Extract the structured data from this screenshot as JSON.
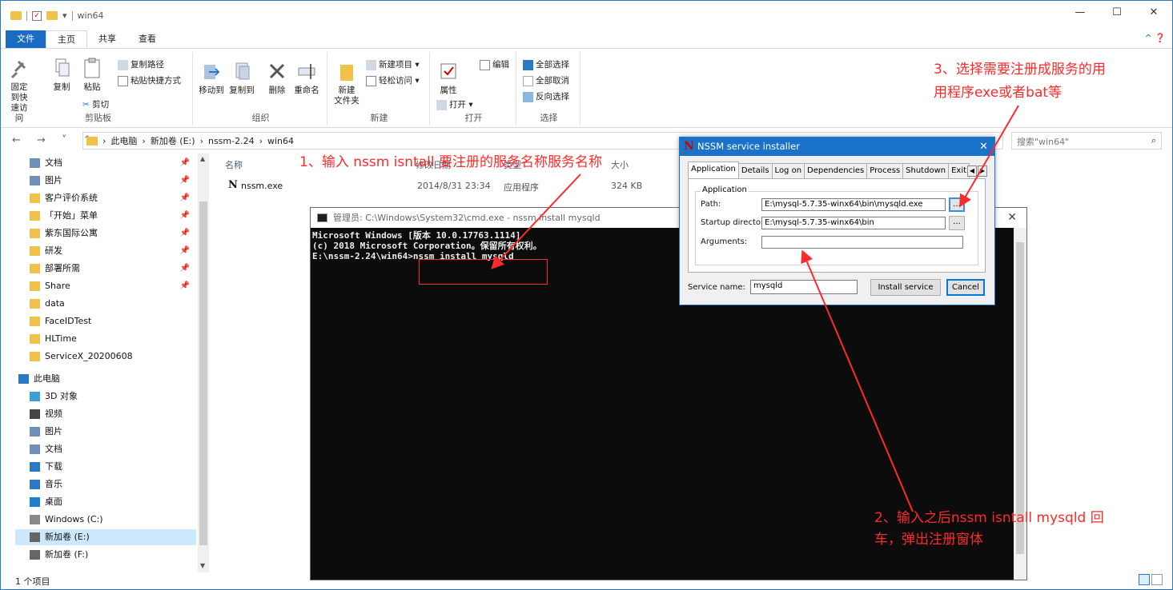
{
  "window": {
    "title": "win64",
    "controls": {
      "minimize": "—",
      "maximize": "☐",
      "close": "✕"
    }
  },
  "ribbon": {
    "tabs": {
      "file": "文件",
      "home": "主页",
      "share": "共享",
      "view": "查看"
    },
    "help": "^ ❓",
    "groups": {
      "clipboard": {
        "label": "剪贴板",
        "pin": "固定到快速访问",
        "pin_l1": "固定到快",
        "pin_l2": "速访问",
        "copy": "复制",
        "paste": "粘贴",
        "copy_path": "复制路径",
        "paste_shortcut": "粘贴快捷方式",
        "cut": "剪切"
      },
      "organize": {
        "label": "组织",
        "move_to": "移动到",
        "copy_to": "复制到",
        "delete": "删除",
        "rename": "重命名"
      },
      "new": {
        "label": "新建",
        "new_folder_l1": "新建",
        "new_folder_l2": "文件夹",
        "new_item": "新建项目 ▾",
        "easy_access": "轻松访问 ▾"
      },
      "open": {
        "label": "打开",
        "properties": "属性",
        "open": "打开 ▾",
        "edit": "编辑"
      },
      "select": {
        "label": "选择",
        "select_all": "全部选择",
        "select_none": "全部取消",
        "invert": "反向选择"
      }
    }
  },
  "address": {
    "nav": "← → ˅ ↑",
    "crumbs": [
      "›",
      "此电脑",
      "›",
      "新加卷 (E:)",
      "›",
      "nssm-2.24",
      "›",
      "win64"
    ],
    "search_placeholder": "搜索\"win64\"",
    "search_icon": "⌕"
  },
  "nav_pane": {
    "quick": [
      {
        "label": "文档",
        "pin": "📌",
        "color": "#6e8fb8"
      },
      {
        "label": "图片",
        "pin": "📌",
        "color": "#6e8fb8"
      },
      {
        "label": "客户评价系统",
        "pin": "📌",
        "color": "#f0c24a"
      },
      {
        "label": "「开始」菜单",
        "pin": "📌",
        "color": "#f0c24a"
      },
      {
        "label": "紫东国际公寓",
        "pin": "📌",
        "color": "#f0c24a"
      },
      {
        "label": "研发",
        "pin": "📌",
        "color": "#f0c24a"
      },
      {
        "label": "部署所需",
        "pin": "📌",
        "color": "#f0c24a"
      },
      {
        "label": "Share",
        "pin": "📌",
        "color": "#f0c24a"
      },
      {
        "label": "data",
        "pin": "",
        "color": "#f0c24a"
      },
      {
        "label": "FaceIDTest",
        "pin": "",
        "color": "#f0c24a"
      },
      {
        "label": "HLTime",
        "pin": "",
        "color": "#f0c24a"
      },
      {
        "label": "ServiceX_20200608",
        "pin": "",
        "color": "#f0c24a"
      }
    ],
    "this_pc": "此电脑",
    "pc_items": [
      {
        "label": "3D 对象",
        "color": "#3aa0d8"
      },
      {
        "label": "视频",
        "color": "#444"
      },
      {
        "label": "图片",
        "color": "#6e8fb8"
      },
      {
        "label": "文档",
        "color": "#6e8fb8"
      },
      {
        "label": "下载",
        "color": "#2b78c5"
      },
      {
        "label": "音乐",
        "color": "#2b78c5"
      },
      {
        "label": "桌面",
        "color": "#1e7fd1"
      },
      {
        "label": "Windows (C:)",
        "color": "#888"
      },
      {
        "label": "新加卷 (E:)",
        "color": "#666"
      },
      {
        "label": "新加卷 (F:)",
        "color": "#666"
      }
    ]
  },
  "file_list": {
    "columns": {
      "name": "名称",
      "date": "修改日期",
      "type": "类型",
      "size": "大小"
    },
    "rows": [
      {
        "icon": "N",
        "name": "nssm.exe",
        "date": "2014/8/31 23:34",
        "type": "应用程序",
        "size": "324 KB"
      }
    ]
  },
  "status": {
    "count": "1 个项目"
  },
  "cmd": {
    "title": "管理员: C:\\Windows\\System32\\cmd.exe - nssm  install mysqld",
    "close": "✕",
    "lines": [
      "Microsoft Windows [版本 10.0.17763.1114]",
      "(c) 2018 Microsoft Corporation。保留所有权利。",
      "",
      "E:\\nssm-2.24\\win64>nssm install mysqld"
    ]
  },
  "nssm": {
    "title": "NSSM service installer",
    "logo": "N",
    "close": "✕",
    "tabs": [
      "Application",
      "Details",
      "Log on",
      "Dependencies",
      "Process",
      "Shutdown",
      "Exit"
    ],
    "tab_arrows": [
      "◀",
      "▶"
    ],
    "group": "Application",
    "path_label": "Path:",
    "path_value": "E:\\mysql-5.7.35-winx64\\bin\\mysqld.exe",
    "startup_label": "Startup directory:",
    "startup_value": "E:\\mysql-5.7.35-winx64\\bin",
    "args_label": "Arguments:",
    "args_value": "",
    "browse": "...",
    "service_name_label": "Service name:",
    "service_name_value": "mysqld",
    "install_btn": "Install service",
    "cancel_btn": "Cancel"
  },
  "annotations": {
    "step1": "1、输入 nssm isntall  要注册的服务名称服务名称",
    "step2_l1": "2、输入之后nssm isntall mysqld 回",
    "step2_l2": "车，弹出注册窗体",
    "step3_l1": "3、选择需要注册成服务的用",
    "step3_l2": "用程序exe或者bat等",
    "color": "#ff2a2a"
  }
}
